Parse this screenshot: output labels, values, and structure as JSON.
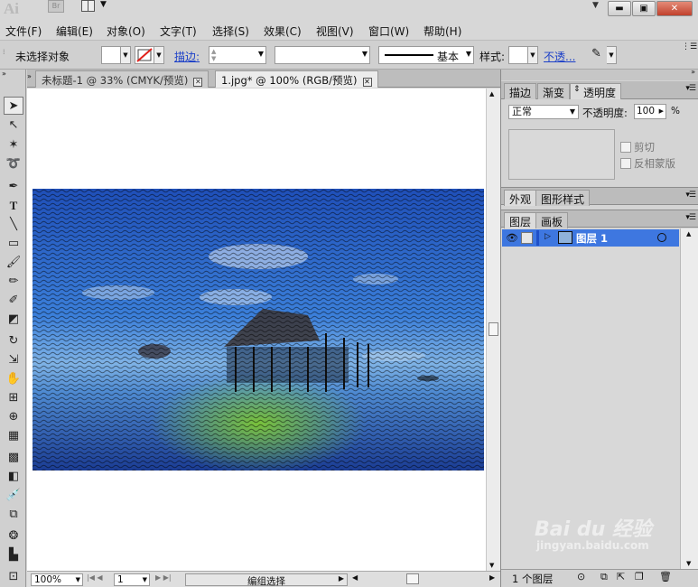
{
  "app": {
    "logo": "Ai",
    "bridge_label": "Br"
  },
  "window_controls": {
    "minimize": "▬",
    "maximize": "▣",
    "close": "✕"
  },
  "menu": [
    "文件(F)",
    "编辑(E)",
    "对象(O)",
    "文字(T)",
    "选择(S)",
    "效果(C)",
    "视图(V)",
    "窗口(W)",
    "帮助(H)"
  ],
  "control_bar": {
    "selection_status": "未选择对象",
    "stroke_label": "描边:",
    "stroke_style": "基本",
    "style_label": "样式:",
    "opacity_link": "不透..."
  },
  "documents": {
    "tabs": [
      {
        "label": "未标题-1 @ 33% (CMYK/预览)",
        "active": false
      },
      {
        "label": "1.jpg* @ 100% (RGB/预览)",
        "active": true
      }
    ]
  },
  "status": {
    "zoom": "100%",
    "artboard_number": "1",
    "tool_status": "编组选择"
  },
  "panels": {
    "group1": {
      "tabs": [
        "描边",
        "渐变",
        "透明度"
      ],
      "blend_mode": "正常",
      "opacity_label": "不透明度:",
      "opacity_value": "100",
      "opacity_unit": "%",
      "clip_label": "剪切",
      "invert_mask_label": "反相蒙版"
    },
    "group2": {
      "tabs": [
        "外观",
        "图形样式"
      ]
    },
    "group3": {
      "tabs": [
        "图层",
        "画板"
      ],
      "layer_name": "图层 1",
      "layer_count": "1 个图层"
    }
  },
  "watermark": {
    "brand": "Bai du 经验",
    "url": "jingyan.baidu.com"
  }
}
